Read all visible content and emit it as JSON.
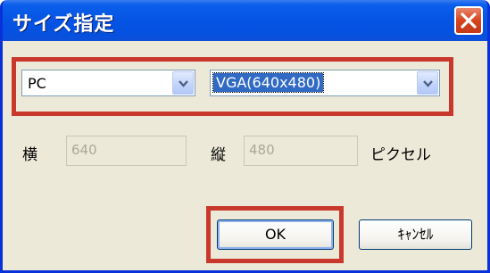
{
  "window": {
    "title": "サイズ指定",
    "close_icon": "close-icon"
  },
  "device_select": {
    "value": "PC",
    "icon": "chevron-down-icon"
  },
  "resolution_select": {
    "value": "VGA(640x480)",
    "icon": "chevron-down-icon"
  },
  "size": {
    "width_label": "横",
    "width_value": "640",
    "height_label": "縦",
    "height_value": "480",
    "unit": "ピクセル"
  },
  "buttons": {
    "ok": "OK",
    "cancel": "ｷｬﾝｾﾙ"
  },
  "colors": {
    "highlight": "#c8382c",
    "titlebar": "#0654e4",
    "dialog_bg": "#ece9d8"
  }
}
